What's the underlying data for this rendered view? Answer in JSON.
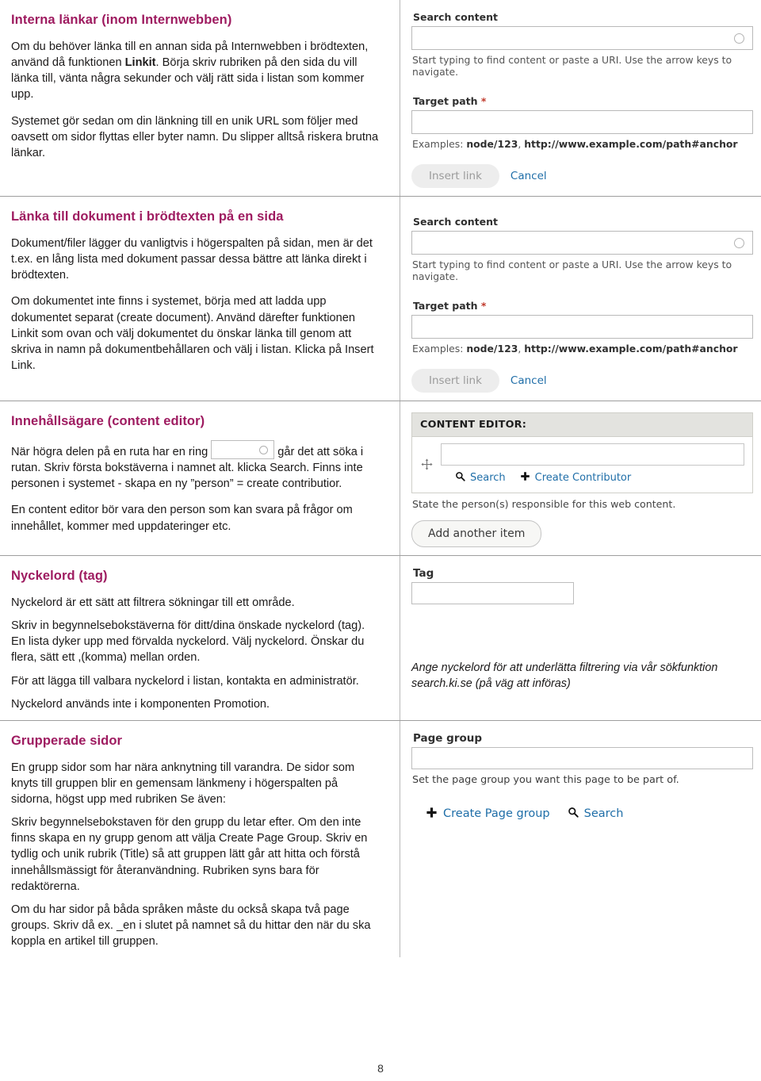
{
  "page": {
    "number": "8"
  },
  "sections": [
    {
      "heading": "Interna länkar (inom Internwebben)",
      "paragraphs": [
        "Om du behöver länka till en annan sida på Internwebben i brödtexten, använd då funktionen ",
        "Systemet gör sedan om din länkning till en unik URL som följer med oavsett om sidor flyttas eller byter namn. Du slipper alltså riskera brutna länkar."
      ],
      "bold_word": "Linkit",
      "paragraph_tail": ". Börja skriv rubriken på den sida du vill länka till, vänta några sekunder och välj rätt sida i listan som kommer upp."
    },
    {
      "heading": "Länka till dokument i brödtexten på en sida",
      "paragraphs": [
        "Dokument/filer lägger du vanligtvis i högerspalten på sidan, men är det t.ex. en lång lista med dokument passar dessa bättre att länka direkt i brödtexten.",
        "Om dokumentet inte finns i systemet, börja med att ladda upp dokumentet separat (create document). Använd därefter funktionen Linkit som ovan och välj dokumentet du önskar länka till genom att skriva in namn på dokumentbehållaren och välj i listan. Klicka på Insert Link."
      ]
    },
    {
      "heading": "Innehållsägare (content editor)",
      "para_a_1": "När högra delen på en ruta har en ring",
      "para_a_2": "går det att söka i rutan. Skriv första bokstäverna i namnet alt. klicka Search. Finns inte personen i systemet -  skapa en ny ”person” = create contributior.",
      "para_b": "En content editor bör vara den person som kan svara på frågor om innehållet, kommer med uppdateringer etc."
    },
    {
      "heading": "Nyckelord  (tag)",
      "paragraphs": [
        "Nyckelord är ett sätt att filtrera sökningar till ett område.",
        "Skriv in begynnelsebokstäverna för ditt/dina önskade nyckelord (tag). En lista dyker upp med förvalda nyckelord. Välj nyckelord. Önskar du flera, sätt ett ,(komma) mellan orden.",
        "För att lägga till valbara nyckelord i listan, kontakta en administratör.",
        "Nyckelord används inte i komponenten Promotion."
      ]
    },
    {
      "heading": "Grupperade sidor",
      "paragraphs": [
        "En grupp sidor som har nära anknytning till varandra. De sidor som knyts till gruppen blir en gemensam länkmeny i högerspalten på sidorna, högst upp med rubriken Se även:",
        "Skriv begynnelsebokstaven för den grupp du letar efter. Om den inte finns skapa en ny grupp genom att välja Create Page Group. Skriv en tydlig och unik rubrik (Title) så att gruppen lätt går att hitta och förstå innehållsmässigt för återanvändning. Rubriken syns bara för redaktörerna.",
        "Om du har sidor på båda språken måste du också  skapa två page groups. Skriv då ex. _en i slutet på namnet så du hittar den när du ska koppla en artikel till gruppen."
      ]
    }
  ],
  "linkit_dialog": {
    "search_label": "Search content",
    "search_value": "",
    "search_hint": "Start typing to find content or paste a URI. Use the arrow keys to navigate.",
    "target_label": "Target path",
    "required_marker": "*",
    "target_value": "",
    "examples_prefix": "Examples: ",
    "example_1": "node/123",
    "example_sep": ", ",
    "example_2": "http://www.example.com/path#anchor",
    "insert_button": "Insert link",
    "cancel_link": "Cancel"
  },
  "content_editor_panel": {
    "title": "CONTENT EDITOR:",
    "input_value": "",
    "search_link": "Search",
    "create_link": "Create Contributor",
    "description": "State the person(s) responsible for this web content.",
    "add_button": "Add another item"
  },
  "tag_panel": {
    "label": "Tag",
    "value": "",
    "caption": "Ange nyckelord för att underlätta filtrering via vår sökfunktion search.ki.se (på väg att införas)"
  },
  "page_group_panel": {
    "label": "Page group",
    "value": "",
    "description": "Set the page group you want this page to be part of.",
    "create_link": "Create Page group",
    "search_link": "Search"
  },
  "colors": {
    "heading": "#9e1b60",
    "link": "#1f6ea8",
    "required": "#c0392b",
    "panel_header_bg": "#e3e3df",
    "divider": "#9e9e9e"
  }
}
